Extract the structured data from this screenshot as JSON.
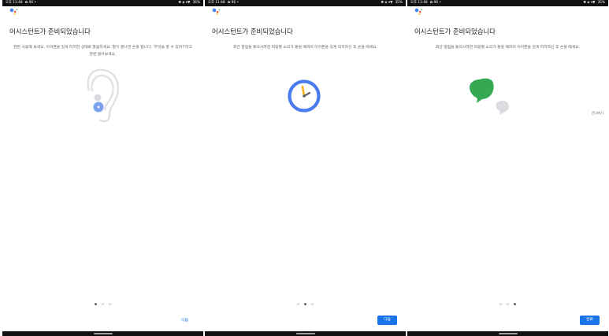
{
  "status": {
    "time": "오후 11:48",
    "notif_glyphs": "✿ 96 •",
    "icons_right": "✱ ◈ ▾▼",
    "battery_panel1": "36%",
    "battery_panel2": "35%",
    "battery_panel3": "35%"
  },
  "panels": [
    {
      "title": "어시스턴트가 준비되었습니다",
      "description": "한번 사용해 보세요. 이어폰을 길게 터치한 상태로 말씀하세요. 말이 끝나면 손을 뗍니다. '무엇을 할 수 있어?'라고 한번 물어보세요.",
      "illustration": "ear-icon",
      "page_index": 0,
      "button_label": "다음",
      "button_style": "text"
    },
    {
      "title": "어시스턴트가 준비되었습니다",
      "description": "최근 알림을 들으시려면 띄링벨 소리가 들릴 때까지 이어폰을 길게 터치하신 후 손을 떼세요.",
      "illustration": "clock-icon",
      "page_index": 1,
      "button_label": "다음",
      "button_style": "filled"
    },
    {
      "title": "어시스턴트가 준비되었습니다",
      "description": "최근 알림을 들으시려면 띄링벨 소리가 들릴 때까지 이어폰을 길게 터치하신 후 손을 떼세요.",
      "illustration": "message-bubbles-icon",
      "page_index": 2,
      "button_label": "완료",
      "button_style": "filled",
      "skip_label": "건너뛰기"
    }
  ],
  "colors": {
    "accent": "#1a73e8",
    "clock_ring": "#4a7cf0",
    "hand_gold": "#f9ab00",
    "bubble_green": "#34a853",
    "bubble_gray": "#dadce0"
  }
}
